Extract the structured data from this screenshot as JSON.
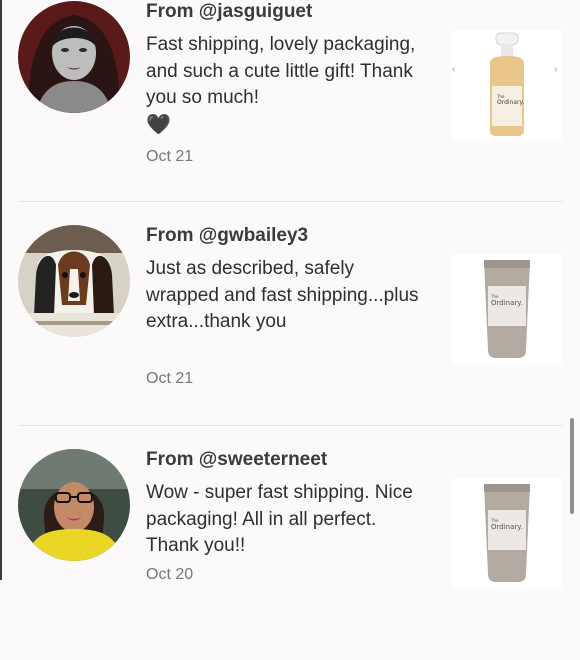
{
  "reviews": [
    {
      "username": "From @jasguiguet",
      "text": "Fast shipping, lovely packaging, and such a cute little gift! Thank you so much!",
      "emoji": "🖤",
      "date": "Oct 21",
      "product_image": "the-ordinary-dropper-bottle",
      "carousel_prev_icon": "chevron-left-icon",
      "carousel_next_icon": "chevron-right-icon"
    },
    {
      "username": "From @gwbailey3",
      "text": "Just as described, safely wrapped and fast shipping...plus extra...thank you",
      "date": "Oct 21",
      "product_image": "the-ordinary-cream-tube"
    },
    {
      "username": "From @sweeterneet",
      "text": "Wow - super fast shipping. Nice packaging! All in all perfect. Thank you!!",
      "date": "Oct 20",
      "product_image": "the-ordinary-cream-tube"
    }
  ],
  "product_brand": "The Ordinary."
}
